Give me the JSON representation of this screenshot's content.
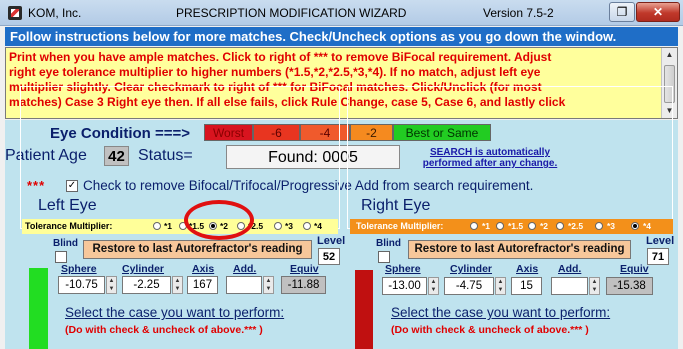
{
  "window": {
    "company": "KOM, Inc.",
    "title": "PRESCRIPTION MODIFICATION WIZARD",
    "version": "Version 7.5-2",
    "restore_glyph": "❐",
    "close_glyph": "✕"
  },
  "follow_bar": "Follow instructions below for more matches. Check/Uncheck options as you go down the window.",
  "instructions": "Print when you have ample matches. Click to right of *** to remove BiFocal requirement. Adjust\nright eye tolerance multiplier to higher numbers (*1.5,*2,*2.5,*3,*4). If no match, adjust left eye\nmultiplier slightly. Clear checkmark to right of *** for BiFocal matches. Click/Unclick (for most\nmatches) Case 3 Right eye then. If all else fails, click Rule Change, case 5, Case 6, and lastly click",
  "eye_condition": {
    "label": "Eye Condition ===>",
    "levels": [
      "Worst",
      "-6",
      "-4",
      "-2",
      "Best or Same"
    ]
  },
  "patient": {
    "age_label": "Patient Age",
    "age": "42",
    "status_label": "Status=",
    "status_value": "Found:  0005"
  },
  "search_note": "SEARCH is automatically performed after any change.",
  "bifocal": {
    "stars": "***",
    "checked": true,
    "label": "Check to remove Bifocal/Trifocal/Progressive Add from search requirement."
  },
  "left_eye": {
    "title": "Left Eye",
    "tolerance_label": "Tolerance Multiplier:",
    "tolerance_options": [
      "*1",
      "*1.5",
      "*2",
      "*2.5",
      "*3",
      "*4"
    ],
    "tolerance_selected": "*1.5",
    "blind_label": "Blind",
    "restore_label": "Restore to last Autorefractor's reading",
    "level_label": "Level",
    "level": "52",
    "fields": {
      "sphere_label": "Sphere",
      "cylinder_label": "Cylinder",
      "axis_label": "Axis",
      "add_label": "Add.",
      "equiv_label": "Equiv",
      "sphere": "-10.75",
      "cylinder": "-2.25",
      "axis": "167",
      "add": "",
      "equiv": "-11.88"
    },
    "case_title": "Select the case you want to perform:",
    "case_sub": "(Do with check & uncheck of above.*** )"
  },
  "right_eye": {
    "title": "Right Eye",
    "tolerance_label": "Tolerance Multiplier:",
    "tolerance_options": [
      "*1",
      "*1.5",
      "*2",
      "*2.5",
      "*3",
      "*4"
    ],
    "tolerance_selected": "*4",
    "blind_label": "Blind",
    "restore_label": "Restore to last Autorefractor's reading",
    "level_label": "Level",
    "level": "71",
    "fields": {
      "sphere_label": "Sphere",
      "cylinder_label": "Cylinder",
      "axis_label": "Axis",
      "add_label": "Add.",
      "equiv_label": "Equiv",
      "sphere": "-13.00",
      "cylinder": "-4.75",
      "axis": "15",
      "add": "",
      "equiv": "-15.38"
    },
    "case_title": "Select the case you want to perform:",
    "case_sub": "(Do with check & uncheck of above.*** )"
  },
  "colors": {
    "follow_bar": "#1f6ec7",
    "instructions_bg": "#ffff9c",
    "main_bg": "#bfe3ee",
    "left_bar": "#22dd22",
    "right_bar": "#c01010",
    "highlight_ring": "#e01010"
  }
}
